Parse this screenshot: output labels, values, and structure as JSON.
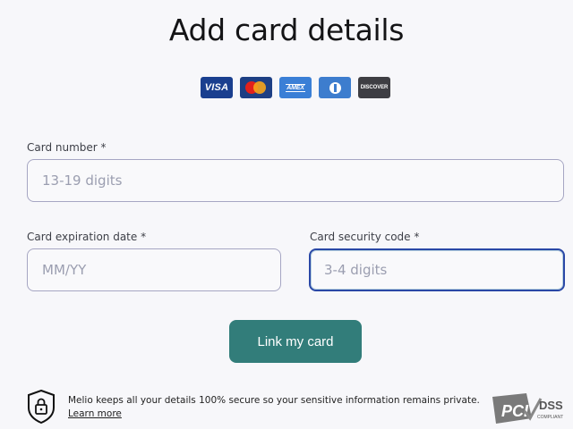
{
  "page": {
    "title": "Add card details"
  },
  "card_brands": [
    {
      "name": "visa",
      "label": "VISA",
      "color": "#1a3f8f"
    },
    {
      "name": "mastercard",
      "color": "#1d3f84"
    },
    {
      "name": "amex",
      "label": "AMEX",
      "color": "#3a7fd6"
    },
    {
      "name": "diners",
      "color": "#3d7dce"
    },
    {
      "name": "discover",
      "label": "DISCOVER",
      "color": "#3e3e43"
    }
  ],
  "form": {
    "card_number": {
      "label": "Card number *",
      "placeholder": "13-19 digits",
      "value": ""
    },
    "expiration": {
      "label": "Card expiration date *",
      "placeholder": "MM/YY",
      "value": ""
    },
    "security_code": {
      "label": "Card security code *",
      "placeholder": "3-4 digits",
      "value": "",
      "focused": true
    },
    "submit_label": "Link my card"
  },
  "footer": {
    "secure_text": "Melio keeps all your details 100% secure so your sensitive information remains private.",
    "learn_more": "Learn more",
    "pci_label": "PCI",
    "dss_label": "DSS",
    "compliant_label": "COMPLIANT"
  },
  "colors": {
    "primary_button": "#327d7a",
    "focus_border": "#2a48a6",
    "field_border": "#a6a6c3",
    "placeholder": "#9b9eb0"
  }
}
